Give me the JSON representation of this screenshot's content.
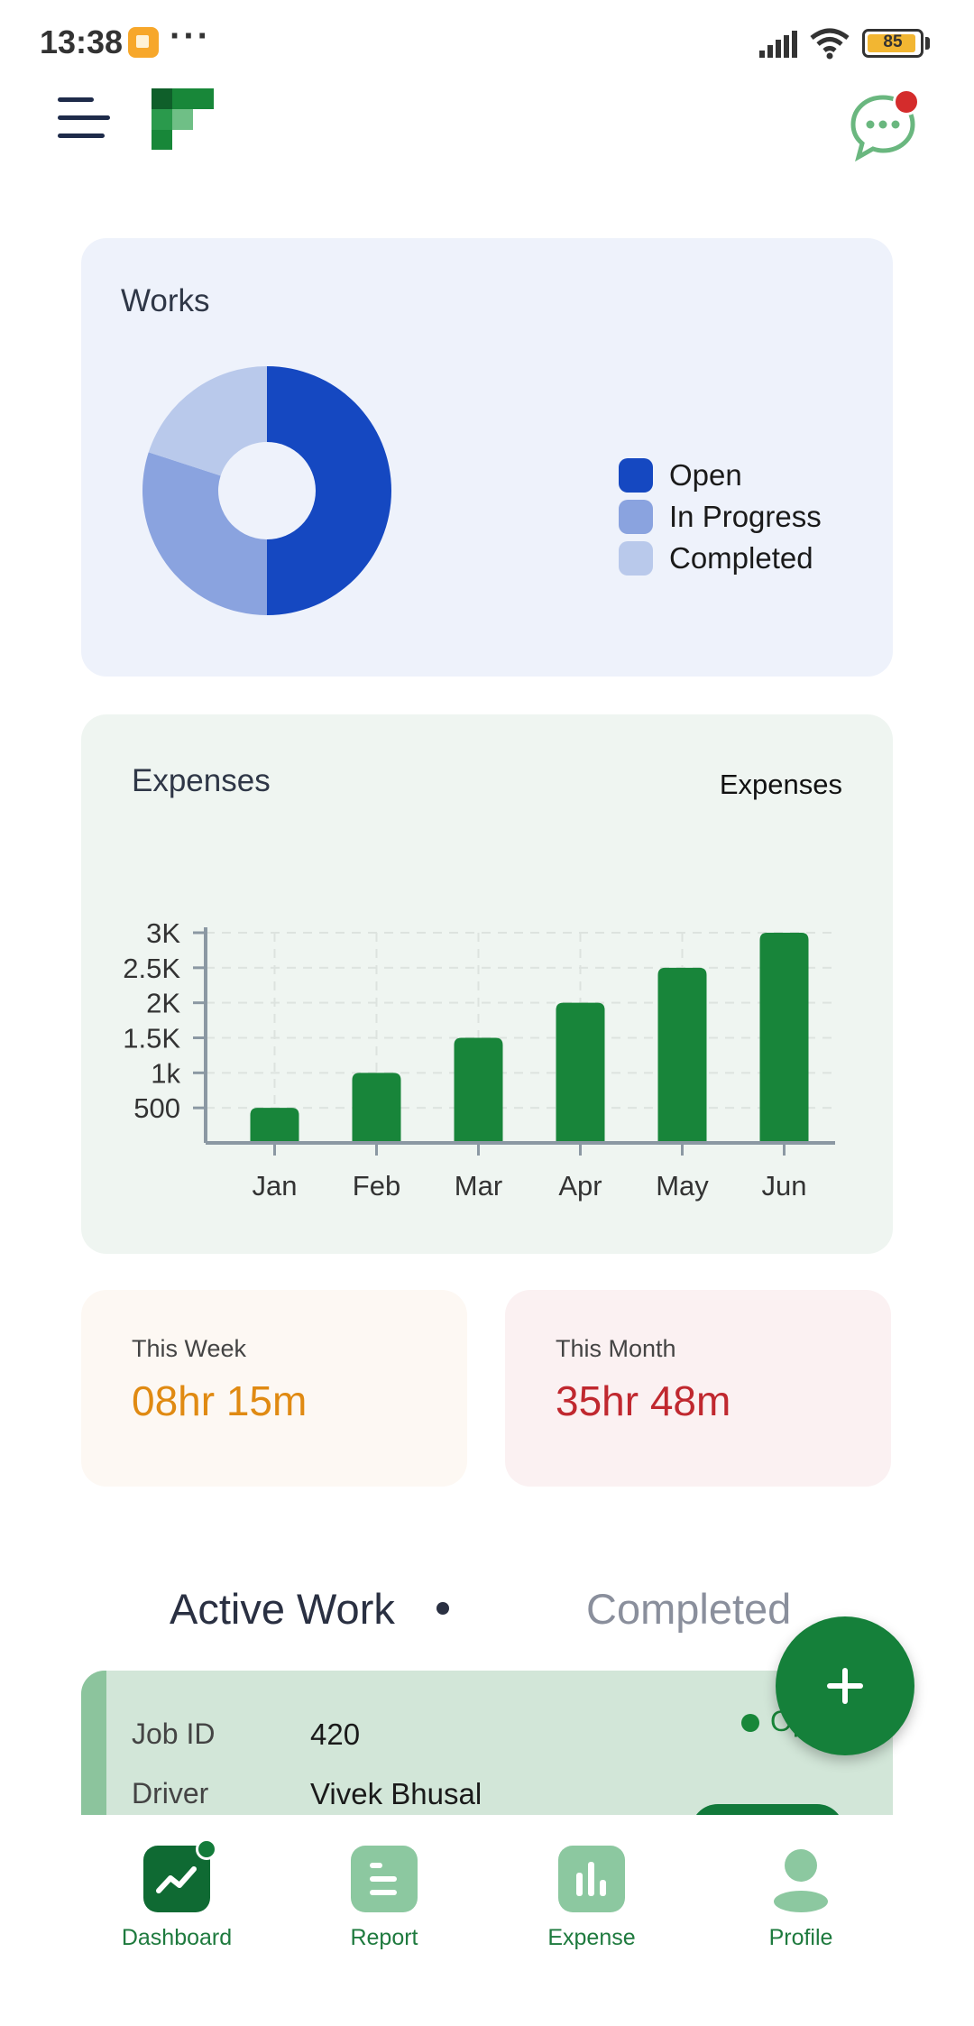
{
  "status_bar": {
    "time": "13:38",
    "battery": "85"
  },
  "header": {
    "menu_icon": "menu-icon",
    "logo": "app-logo",
    "chat_icon": "chat-icon"
  },
  "works": {
    "title": "Works",
    "segments": [
      {
        "label": "Open",
        "value": 50,
        "color": "#1548c1"
      },
      {
        "label": "In Progress",
        "value": 30,
        "color": "#8aa3df"
      },
      {
        "label": "Completed",
        "value": 20,
        "color": "#b9c9eb"
      }
    ]
  },
  "expenses": {
    "title": "Expenses",
    "legend_label": "Expenses"
  },
  "chart_data": {
    "type": "bar",
    "title": "Expenses",
    "categories": [
      "Jan",
      "Feb",
      "Mar",
      "Apr",
      "May",
      "Jun"
    ],
    "series": [
      {
        "name": "Expenses",
        "values": [
          500,
          1000,
          1500,
          2000,
          2500,
          3000
        ],
        "color": "#18853a"
      }
    ],
    "ylim": [
      0,
      3000
    ],
    "y_ticks": [
      {
        "value": 500,
        "label": "500"
      },
      {
        "value": 1000,
        "label": "1k"
      },
      {
        "value": 1500,
        "label": "1.5K"
      },
      {
        "value": 2000,
        "label": "2K"
      },
      {
        "value": 2500,
        "label": "2.5K"
      },
      {
        "value": 3000,
        "label": "3K"
      }
    ],
    "grid": true,
    "legend": "top-right"
  },
  "stats": {
    "week": {
      "label": "This Week",
      "value": "08hr 15m"
    },
    "month": {
      "label": "This Month",
      "value": "35hr 48m"
    }
  },
  "tabs": {
    "active": "Active Work",
    "inactive": "Completed"
  },
  "job": {
    "rows": [
      {
        "label": "Job ID",
        "value": "420"
      },
      {
        "label": "Driver",
        "value": "Vivek Bhusal"
      }
    ],
    "status": "Op"
  },
  "fab": {
    "icon": "plus-icon"
  },
  "bottom_nav": [
    {
      "label": "Dashboard",
      "icon": "dashboard-icon"
    },
    {
      "label": "Report",
      "icon": "report-icon"
    },
    {
      "label": "Expense",
      "icon": "expense-icon"
    },
    {
      "label": "Profile",
      "icon": "profile-icon"
    }
  ]
}
